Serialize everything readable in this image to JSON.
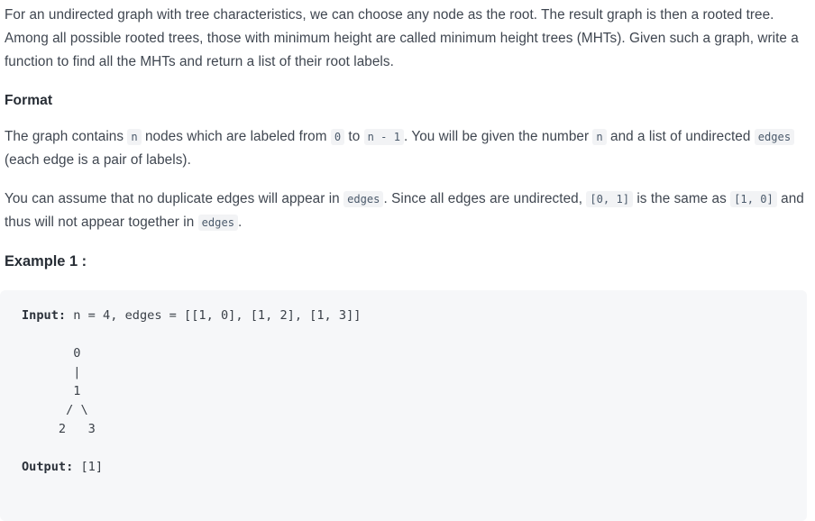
{
  "problem": {
    "description": {
      "text_before_1": "For an undirected graph with tree characteristics, we can choose any node as the root. The result graph is then a rooted tree. Among all possible rooted trees, those with minimum height are called minimum height trees (MHTs). Given such a graph, write a function to find all the MHTs and return a list of their root labels."
    },
    "format_section": {
      "heading": "Format",
      "para1_seg1": "The graph contains ",
      "para1_code1": "n",
      "para1_seg2": " nodes which are labeled from ",
      "para1_code2": "0",
      "para1_seg3": " to ",
      "para1_code3": "n - 1",
      "para1_seg4": ". You will be given the number ",
      "para1_code4": "n",
      "para1_seg5": " and a list of undirected ",
      "para1_code5": "edges",
      "para1_seg6": " (each edge is a pair of labels).",
      "para2_seg1": "You can assume that no duplicate edges will appear in ",
      "para2_code1": "edges",
      "para2_seg2": ". Since all edges are undirected, ",
      "para2_code2": "[0, 1]",
      "para2_seg3": " is the same as ",
      "para2_code3": "[1, 0]",
      "para2_seg4": " and thus will not appear together in ",
      "para2_code4": "edges",
      "para2_seg5": "."
    },
    "example": {
      "heading": "Example 1 :",
      "input_label": "Input:",
      "input_value": " n = 4, edges = [[1, 0], [1, 2], [1, 3]]",
      "diagram_lines": [
        "       0",
        "       |",
        "       1",
        "      / \\",
        "     2   3"
      ],
      "output_label": "Output:",
      "output_value": " [1]"
    }
  },
  "colors": {
    "body_text": "#3f4650",
    "heading_text": "#272d35",
    "code_block_bg": "#f6f7f9",
    "inline_code_bg": "#f2f3f5",
    "inline_code_text": "#4b5a6b",
    "page_bg": "#ffffff"
  }
}
